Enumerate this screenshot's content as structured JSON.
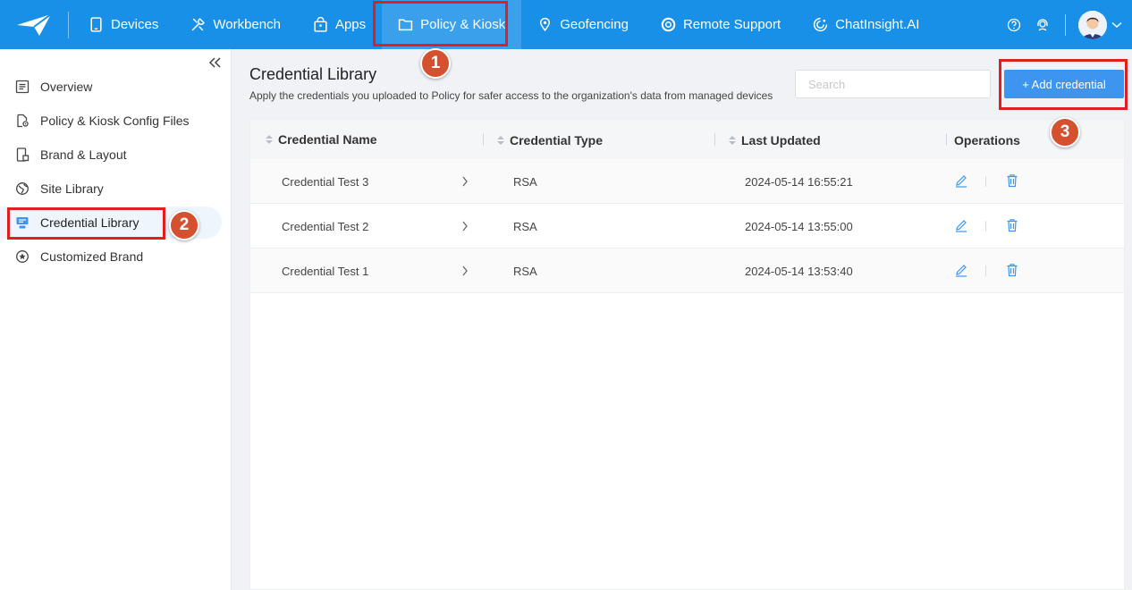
{
  "nav": {
    "items": [
      {
        "label": "Devices",
        "icon": "tablet-icon"
      },
      {
        "label": "Workbench",
        "icon": "tools-icon"
      },
      {
        "label": "Apps",
        "icon": "bag-icon"
      },
      {
        "label": "Policy & Kiosk",
        "icon": "folder-icon"
      },
      {
        "label": "Geofencing",
        "icon": "map-pin-icon"
      },
      {
        "label": "Remote Support",
        "icon": "lifebuoy-icon"
      },
      {
        "label": "ChatInsight.AI",
        "icon": "ai-icon"
      }
    ],
    "active": "Policy & Kiosk"
  },
  "sidebar": {
    "items": [
      {
        "label": "Overview",
        "icon": "list-icon"
      },
      {
        "label": "Policy & Kiosk Config Files",
        "icon": "file-gear-icon"
      },
      {
        "label": "Brand & Layout",
        "icon": "device-layout-icon"
      },
      {
        "label": "Site Library",
        "icon": "globe-icon"
      },
      {
        "label": "Credential Library",
        "icon": "credential-icon"
      },
      {
        "label": "Customized Brand",
        "icon": "star-icon"
      }
    ],
    "active": "Credential Library"
  },
  "page": {
    "title": "Credential Library",
    "description": "Apply the credentials you uploaded to Policy for safer access to the organization's data from managed devices",
    "search_placeholder": "Search",
    "add_button": "+ Add credential"
  },
  "table": {
    "headers": [
      "Credential Name",
      "Credential Type",
      "Last Updated",
      "Operations"
    ],
    "rows": [
      {
        "name": "Credential Test 3",
        "type": "RSA",
        "updated": "2024-05-14 16:55:21"
      },
      {
        "name": "Credential Test 2",
        "type": "RSA",
        "updated": "2024-05-14 13:55:00"
      },
      {
        "name": "Credential Test 1",
        "type": "RSA",
        "updated": "2024-05-14 13:53:40"
      }
    ]
  },
  "callouts": [
    "1",
    "2",
    "3"
  ],
  "colors": {
    "nav_bg": "#1890e8",
    "accent": "#3d95f0",
    "highlight": "#e02020",
    "badge": "#d4502f"
  }
}
